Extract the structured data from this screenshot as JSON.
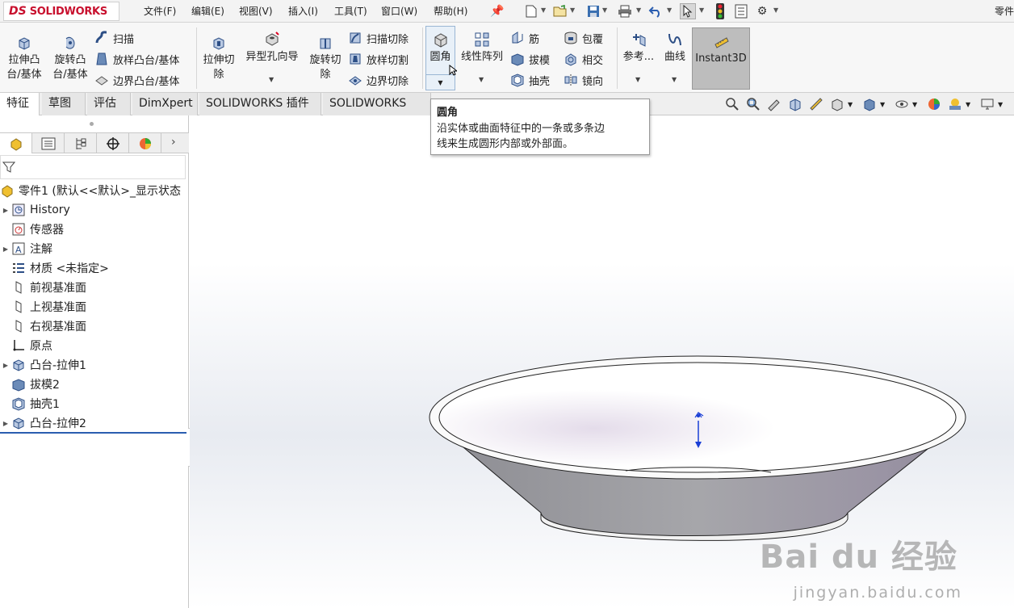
{
  "app": {
    "brand": "SOLIDWORKS",
    "part_name": "零件"
  },
  "menu": [
    "文件(F)",
    "编辑(E)",
    "视图(V)",
    "插入(I)",
    "工具(T)",
    "窗口(W)",
    "帮助(H)"
  ],
  "ribbon": {
    "extrude_boss": "拉伸凸台/基体",
    "extrude_boss_l1": "拉伸凸",
    "extrude_boss_l2": "台/基体",
    "revolve_boss_l1": "旋转凸",
    "revolve_boss_l2": "台/基体",
    "sweep": "扫描",
    "loft_boss": "放样凸台/基体",
    "boundary_boss": "边界凸台/基体",
    "extrude_cut_l1": "拉伸切",
    "extrude_cut_l2": "除",
    "hole_wizard": "异型孔向导",
    "revolve_cut_l1": "旋转切",
    "revolve_cut_l2": "除",
    "sweep_cut": "扫描切除",
    "loft_cut": "放样切割",
    "boundary_cut": "边界切除",
    "fillet": "圆角",
    "linear_pattern": "线性阵列",
    "rib": "筋",
    "draft": "拔模",
    "shell": "抽壳",
    "wrap": "包覆",
    "intersect": "相交",
    "mirror": "镜向",
    "reference": "参考...",
    "curves": "曲线",
    "instant3d": "Instant3D"
  },
  "tabs": [
    "特征",
    "草图",
    "评估",
    "DimXpert",
    "SOLIDWORKS 插件",
    "SOLIDWORKS MBD"
  ],
  "tooltip": {
    "title": "圆角",
    "body_l1": "沿实体或曲面特征中的一条或多条边",
    "body_l2": "线来生成圆形内部或外部面。"
  },
  "tree": {
    "root": "零件1  (默认<<默认>_显示状态",
    "items": [
      {
        "label": "History",
        "icon": "history-icon",
        "expandable": true
      },
      {
        "label": "传感器",
        "icon": "sensor-icon",
        "expandable": false
      },
      {
        "label": "注解",
        "icon": "annotation-icon",
        "expandable": true
      },
      {
        "label": "材质 <未指定>",
        "icon": "material-icon",
        "expandable": false
      },
      {
        "label": "前视基准面",
        "icon": "plane-icon",
        "expandable": false
      },
      {
        "label": "上视基准面",
        "icon": "plane-icon",
        "expandable": false
      },
      {
        "label": "右视基准面",
        "icon": "plane-icon",
        "expandable": false
      },
      {
        "label": "原点",
        "icon": "origin-icon",
        "expandable": false
      },
      {
        "label": "凸台-拉伸1",
        "icon": "extrude-feature-icon",
        "expandable": true
      },
      {
        "label": "拔模2",
        "icon": "draft-feature-icon",
        "expandable": false
      },
      {
        "label": "抽壳1",
        "icon": "shell-feature-icon",
        "expandable": false
      },
      {
        "label": "凸台-拉伸2",
        "icon": "extrude-feature-icon",
        "expandable": true
      }
    ]
  },
  "watermark": {
    "text": "Bai du 经验",
    "url": "jingyan.baidu.com"
  },
  "colors": {
    "brand_red": "#c8102e",
    "rollback_bar": "#2a5db0",
    "axis_blue": "#1a3fd6"
  }
}
